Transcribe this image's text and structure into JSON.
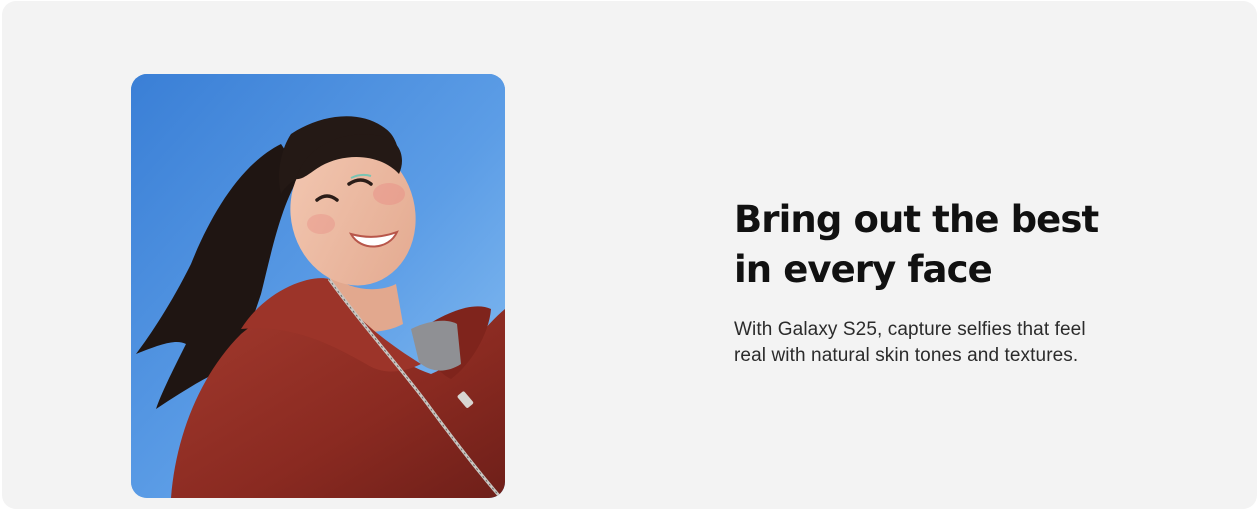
{
  "feature": {
    "headline_lines": [
      "Bring out the best",
      "in every face"
    ],
    "description_lines": [
      "With Galaxy S25, capture selfies that feel",
      "real with natural skin tones and textures."
    ]
  },
  "colors": {
    "panel_background": "#f3f3f3",
    "headline_text": "#111111",
    "body_text": "#2b2b2b",
    "sky": "#5d9ee6",
    "jacket": "#8e2b22"
  }
}
